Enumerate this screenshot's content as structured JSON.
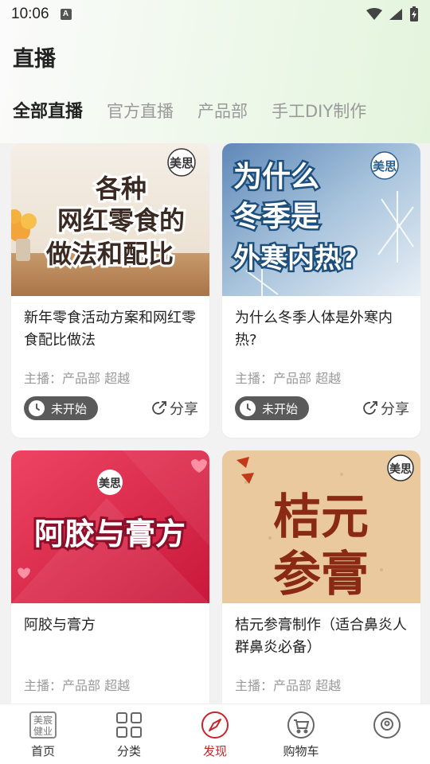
{
  "status_bar": {
    "time": "10:06",
    "notif_letter": "A"
  },
  "page": {
    "title": "直播"
  },
  "tabs": [
    {
      "label": "全部直播",
      "active": true
    },
    {
      "label": "官方直播",
      "active": false
    },
    {
      "label": "产品部",
      "active": false
    },
    {
      "label": "手工DIY制作",
      "active": false
    }
  ],
  "cards": [
    {
      "image_text": [
        "各种",
        "网红零食的",
        "做法和配比"
      ],
      "title": "新年零食活动方案和网红零食配比做法",
      "host": "主播：产品部 超越",
      "status": "未开始",
      "share": "分享"
    },
    {
      "image_text": [
        "为什么",
        "冬季是",
        "外寒内热?"
      ],
      "title": "为什么冬季人体是外寒内热?",
      "host": "主播：产品部 超越",
      "status": "未开始",
      "share": "分享"
    },
    {
      "image_text": [
        "阿胶与膏方"
      ],
      "title": "阿胶与膏方",
      "host": "主播：产品部 超越"
    },
    {
      "image_text": [
        "桔元",
        "参膏"
      ],
      "title": "桔元参膏制作（适合鼻炎人群鼻炎必备）",
      "host": "主播：产品部 超越"
    }
  ],
  "logo_text": "美思",
  "bottom_nav": [
    {
      "label": "首页",
      "icon": "brand-logo-icon",
      "logo_text": [
        "美宸",
        "健业"
      ]
    },
    {
      "label": "分类",
      "icon": "grid-icon"
    },
    {
      "label": "发现",
      "icon": "compass-icon",
      "active": true
    },
    {
      "label": "购物车",
      "icon": "cart-icon"
    },
    {
      "label": "",
      "icon": "profile-icon"
    }
  ],
  "colors": {
    "accent_red": "#c8242b",
    "pill_bg": "#5a5a5a",
    "header_green": "#e3f4dc"
  }
}
